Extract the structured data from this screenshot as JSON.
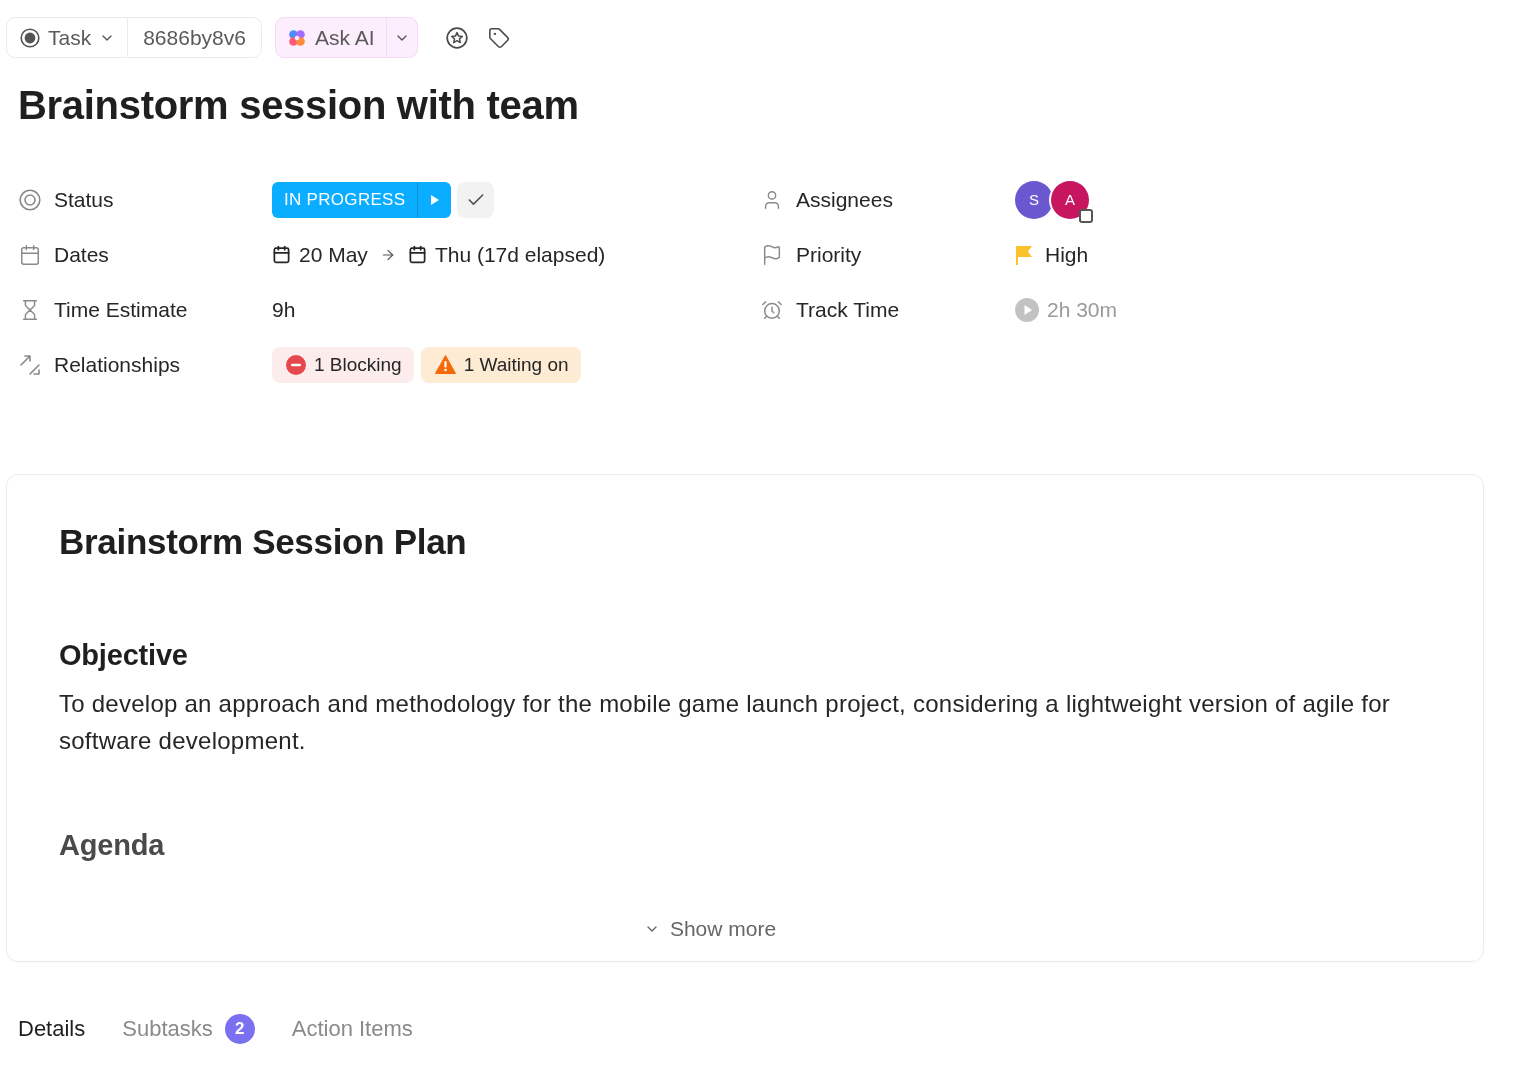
{
  "toolbar": {
    "type_selector": {
      "label": "Task"
    },
    "task_id": "8686by8v6",
    "ask_ai": {
      "label": "Ask AI"
    }
  },
  "title": "Brainstorm session with team",
  "properties": {
    "left": [
      {
        "kind": "status",
        "label": "Status",
        "value": "IN PROGRESS"
      },
      {
        "kind": "dates",
        "label": "Dates",
        "start": "20 May",
        "end": "Thu (17d elapsed)"
      },
      {
        "kind": "estimate",
        "label": "Time Estimate",
        "value": "9h"
      },
      {
        "kind": "relationships",
        "label": "Relationships",
        "items": [
          {
            "kind": "blocking",
            "label": "1 Blocking"
          },
          {
            "kind": "waiting",
            "label": "1 Waiting on"
          }
        ]
      }
    ],
    "right": [
      {
        "kind": "assignees",
        "label": "Assignees",
        "people": [
          {
            "initial": "S",
            "color": "#6b57d0"
          },
          {
            "initial": "A",
            "color": "#c8155f"
          }
        ]
      },
      {
        "kind": "priority",
        "label": "Priority",
        "value": "High"
      },
      {
        "kind": "timer",
        "label": "Track Time",
        "value": "2h 30m"
      }
    ]
  },
  "description": {
    "heading": "Brainstorm Session Plan",
    "sections": [
      {
        "heading": "Objective",
        "text": "To develop an approach and methodology for the mobile game launch project, considering a lightweight version of agile for software development."
      },
      {
        "heading": "Agenda"
      }
    ],
    "show_more": "Show more"
  },
  "tabs": [
    {
      "label": "Details",
      "selected": true
    },
    {
      "label": "Subtasks",
      "selected": false,
      "count": "2"
    },
    {
      "label": "Action Items",
      "selected": false
    }
  ]
}
